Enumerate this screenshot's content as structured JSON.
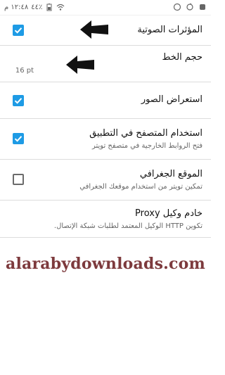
{
  "status_bar": {
    "time": "١٢:٤٨ م",
    "battery": "٤٤٪"
  },
  "settings": [
    {
      "title": "المؤثرات الصوتية",
      "subtitle": "",
      "checkbox": true,
      "checked": true
    },
    {
      "title": "حجم الخط",
      "subtitle": "16 pt",
      "checkbox": false,
      "checked": false
    },
    {
      "title": "استعراض الصور",
      "subtitle": "",
      "checkbox": true,
      "checked": true
    },
    {
      "title": "استخدام المتصفح في التطبيق",
      "subtitle": "فتح الروابط الخارجية في متصفح تويتر",
      "checkbox": true,
      "checked": true
    },
    {
      "title": "الموقع الجغرافي",
      "subtitle": "تمكين تويتر من استخدام موقعك الجغرافي",
      "checkbox": true,
      "checked": false
    },
    {
      "title": "خادم وكيل Proxy",
      "subtitle": "تكوين HTTP الوكيل المعتمد لطلبات شبكة الإتصال.",
      "checkbox": false,
      "checked": false
    }
  ],
  "watermark": "alarabydownloads.com",
  "colors": {
    "accent": "#1e9be5",
    "watermark": "#7d3a3d"
  }
}
